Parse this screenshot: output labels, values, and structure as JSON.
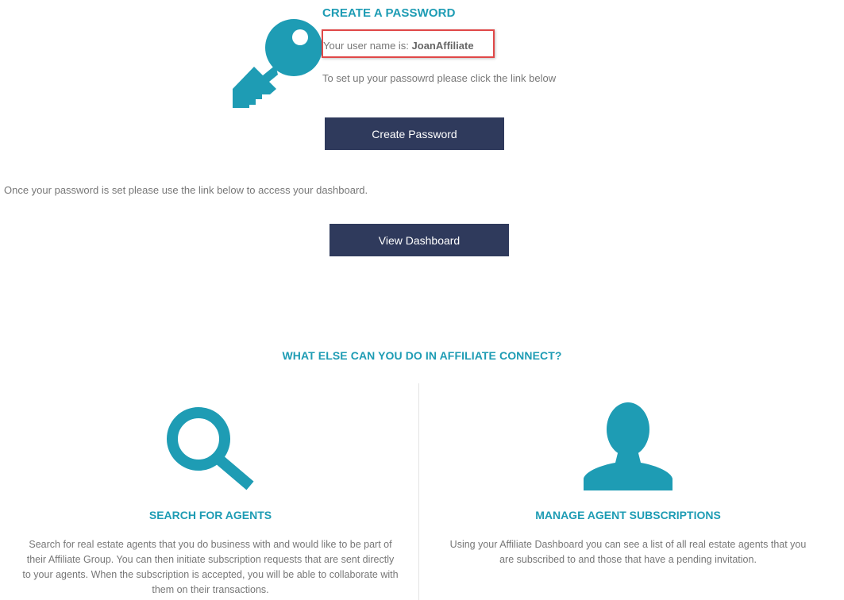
{
  "create_section": {
    "title": "CREATE A PASSWORD",
    "username_prefix": "Your user name is: ",
    "username": "JoanAffiliate",
    "setup_text": "To set up your passowrd please click the link below",
    "create_button": "Create Password"
  },
  "dashboard_section": {
    "note": "Once your password is set please use the link below to access your dashboard.",
    "view_button": "View Dashboard"
  },
  "features_section": {
    "heading": "WHAT ELSE CAN YOU DO IN AFFILIATE CONNECT?",
    "features": [
      {
        "icon": "search-icon",
        "title": "SEARCH FOR AGENTS",
        "description": "Search for real estate agents that you do business with and would like to be part of their Affiliate Group. You can then initiate subscription requests that are sent directly to your agents. When the subscription is accepted, you will be able to collaborate with them on their transactions."
      },
      {
        "icon": "person-icon",
        "title": "MANAGE AGENT SUBSCRIPTIONS",
        "description": "Using your Affiliate Dashboard you can see a list of all real estate agents that you are subscribed to and those that have a pending invitation."
      }
    ]
  },
  "colors": {
    "accent": "#1e9cb4",
    "button_bg": "#2f3a5c",
    "highlight_border": "#e04848",
    "body_text": "#777777"
  }
}
